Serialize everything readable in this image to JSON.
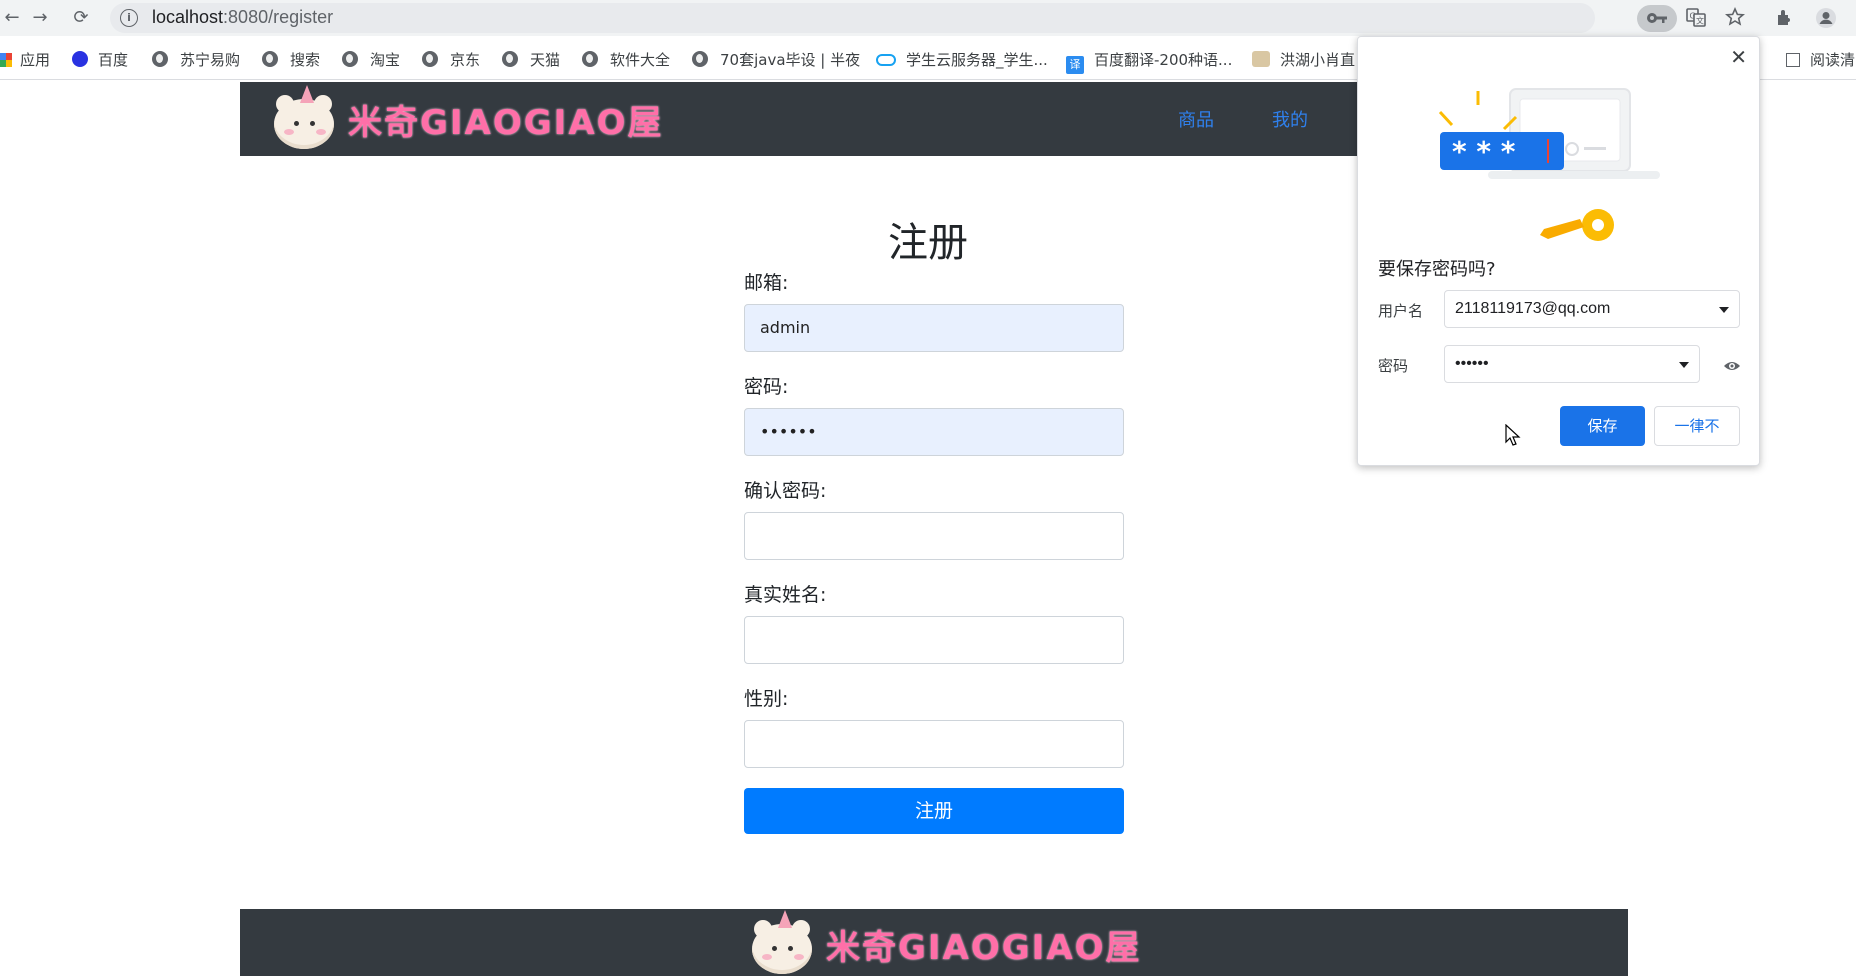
{
  "browser": {
    "url_host": "localhost",
    "url_rest": ":8080/register",
    "bookmarks": [
      "应用",
      "百度",
      "苏宁易购",
      "搜索",
      "淘宝",
      "京东",
      "天猫",
      "软件大全",
      "70套java毕设 | 半夜",
      "学生云服务器_学生...",
      "百度翻译-200种语...",
      "洪湖小肖直",
      "阅读清"
    ]
  },
  "site": {
    "logo_text": "米奇GIAOGIAO屋",
    "nav": [
      "商品",
      "我的"
    ]
  },
  "form": {
    "title": "注册",
    "email_label": "邮箱:",
    "email_value": "admin",
    "password_label": "密码:",
    "password_value": "••••••",
    "confirm_label": "确认密码:",
    "confirm_value": "",
    "realname_label": "真实姓名:",
    "realname_value": "",
    "gender_label": "性别:",
    "gender_value": "",
    "submit_label": "注册"
  },
  "password_popup": {
    "title": "要保存密码吗?",
    "username_label": "用户名",
    "username_value": "2118119173@qq.com",
    "password_label": "密码",
    "password_value": "••••••",
    "save_label": "保存",
    "never_label": "一律不"
  }
}
